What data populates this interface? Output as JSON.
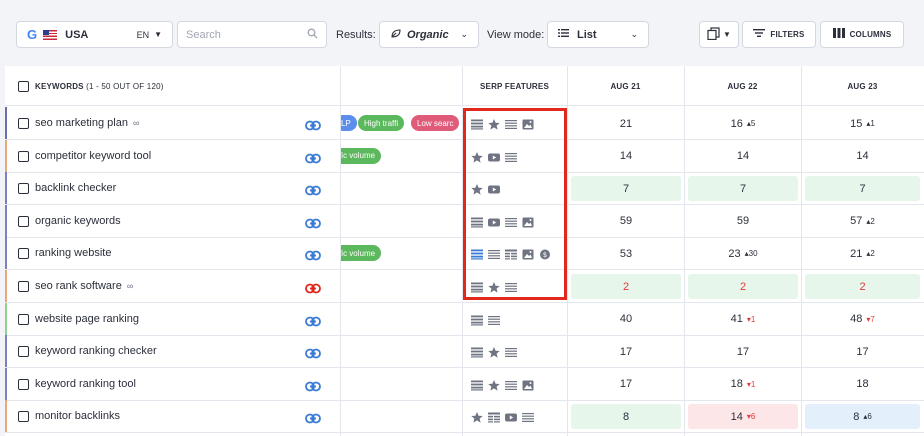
{
  "toolbar": {
    "engine_icon": "google-g-icon",
    "country": "USA",
    "language": "EN",
    "search_placeholder": "Search",
    "results_label": "Results:",
    "results_value": "Organic",
    "viewmode_label": "View mode:",
    "viewmode_value": "List",
    "filters_label": "FILTERS",
    "columns_label": "COLUMNS"
  },
  "table": {
    "keywords_header": "KEYWORDS",
    "keywords_count": "(1 - 50 OUT OF 120)",
    "serp_header": "SERP FEATURES",
    "dates": [
      "AUG 21",
      "AUG 22",
      "AUG 23"
    ],
    "rows": [
      {
        "keyword": "seo marketing plan",
        "chain": true,
        "link_color": "#3a7bd5",
        "stripe": "#6b6fa8",
        "tags": [
          {
            "text": "LP",
            "color": "#5b8def",
            "pos": "first"
          },
          {
            "text": "High traffi",
            "color": "#5cb85c",
            "pos": "mid"
          },
          {
            "text": "Low searc",
            "color": "#e05a7a",
            "pos": "last"
          }
        ],
        "serp": [
          "list",
          "star",
          "lines",
          "image"
        ],
        "pos": [
          {
            "v": "21",
            "c": "",
            "bg": ""
          },
          {
            "v": "16",
            "c": "5",
            "d": "up",
            "bg": ""
          },
          {
            "v": "15",
            "c": "1",
            "d": "up",
            "bg": ""
          }
        ]
      },
      {
        "keyword": "competitor keyword tool",
        "chain": false,
        "link_color": "#3a7bd5",
        "stripe": "#e8a87c",
        "tags": [
          {
            "text": "ffic volume",
            "color": "#5cb85c",
            "pos": "cut"
          }
        ],
        "serp": [
          "star",
          "video",
          "lines"
        ],
        "pos": [
          {
            "v": "14",
            "c": "",
            "bg": ""
          },
          {
            "v": "14",
            "c": "",
            "bg": ""
          },
          {
            "v": "14",
            "c": "",
            "bg": ""
          }
        ]
      },
      {
        "keyword": "backlink checker",
        "chain": false,
        "link_color": "#3a7bd5",
        "stripe": "#7a80c0",
        "tags": [],
        "serp": [
          "star",
          "video"
        ],
        "pos": [
          {
            "v": "7",
            "c": "",
            "bg": "green"
          },
          {
            "v": "7",
            "c": "",
            "bg": "green"
          },
          {
            "v": "7",
            "c": "",
            "bg": "green"
          }
        ]
      },
      {
        "keyword": "organic keywords",
        "chain": false,
        "link_color": "#3a7bd5",
        "stripe": "#7a80c0",
        "tags": [],
        "serp": [
          "list",
          "video",
          "lines",
          "image"
        ],
        "pos": [
          {
            "v": "59",
            "c": "",
            "bg": ""
          },
          {
            "v": "59",
            "c": "",
            "bg": ""
          },
          {
            "v": "57",
            "c": "2",
            "d": "up",
            "bg": ""
          }
        ]
      },
      {
        "keyword": "ranking website",
        "chain": false,
        "link_color": "#3a7bd5",
        "stripe": "#7a80c0",
        "tags": [
          {
            "text": "ffic volume",
            "color": "#5cb85c",
            "pos": "cut"
          }
        ],
        "serp": [
          "list-blue",
          "lines",
          "table",
          "image",
          "coin"
        ],
        "pos": [
          {
            "v": "53",
            "c": "",
            "bg": ""
          },
          {
            "v": "23",
            "c": "30",
            "d": "up",
            "bg": ""
          },
          {
            "v": "21",
            "c": "2",
            "d": "up",
            "bg": ""
          }
        ]
      },
      {
        "keyword": "seo rank software",
        "chain": true,
        "link_color": "#e0281e",
        "stripe": "#e8a87c",
        "tags": [],
        "serp": [
          "list",
          "star",
          "lines"
        ],
        "pos": [
          {
            "v": "2",
            "c": "",
            "bg": "green",
            "red": true
          },
          {
            "v": "2",
            "c": "",
            "bg": "green",
            "red": true
          },
          {
            "v": "2",
            "c": "",
            "bg": "green",
            "red": true
          }
        ]
      },
      {
        "keyword": "website page ranking",
        "chain": false,
        "link_color": "#3a7bd5",
        "stripe": "#8fd08f",
        "tags": [],
        "serp": [
          "list",
          "lines"
        ],
        "pos": [
          {
            "v": "40",
            "c": "",
            "bg": ""
          },
          {
            "v": "41",
            "c": "1",
            "d": "down",
            "bg": ""
          },
          {
            "v": "48",
            "c": "7",
            "d": "down",
            "bg": ""
          }
        ]
      },
      {
        "keyword": "keyword ranking checker",
        "chain": false,
        "link_color": "#3a7bd5",
        "stripe": "#7a80c0",
        "tags": [],
        "serp": [
          "list",
          "star",
          "lines"
        ],
        "pos": [
          {
            "v": "17",
            "c": "",
            "bg": ""
          },
          {
            "v": "17",
            "c": "",
            "bg": ""
          },
          {
            "v": "17",
            "c": "",
            "bg": ""
          }
        ]
      },
      {
        "keyword": "keyword ranking tool",
        "chain": false,
        "link_color": "#3a7bd5",
        "stripe": "#7a80c0",
        "tags": [],
        "serp": [
          "list",
          "star",
          "lines",
          "image"
        ],
        "pos": [
          {
            "v": "17",
            "c": "",
            "bg": ""
          },
          {
            "v": "18",
            "c": "1",
            "d": "down",
            "bg": ""
          },
          {
            "v": "18",
            "c": "",
            "bg": ""
          }
        ]
      },
      {
        "keyword": "monitor backlinks",
        "chain": false,
        "link_color": "#3a7bd5",
        "stripe": "#e8a87c",
        "tags": [],
        "serp": [
          "star",
          "table",
          "video",
          "lines"
        ],
        "pos": [
          {
            "v": "8",
            "c": "",
            "bg": "green"
          },
          {
            "v": "14",
            "c": "6",
            "d": "down",
            "bg": "red"
          },
          {
            "v": "8",
            "c": "6",
            "d": "up",
            "bg": "blue"
          }
        ]
      }
    ]
  },
  "colors": {
    "highlight_box": "#e0281e",
    "link": "#3a7bd5"
  }
}
